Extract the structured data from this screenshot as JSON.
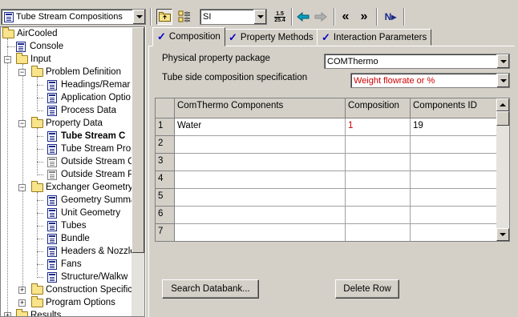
{
  "toolbar": {
    "nav_combo": "Tube Stream Compositions",
    "units_combo": "SI",
    "icons": [
      "tree-view-icon",
      "new-folder-icon",
      "list-icon",
      "units-conversion-icon",
      "back-arrow-icon",
      "forward-arrow-icon",
      "previous-icon",
      "next-icon",
      "next-input-icon"
    ],
    "units_glyph_top": "1.5",
    "units_glyph_bottom": "25.4",
    "prev_glyph": "«",
    "next_glyph": "»",
    "next_input_glyph": "N▸"
  },
  "tree": {
    "root": "AirCooled",
    "console": "Console",
    "input": "Input",
    "problem_definition": "Problem Definition",
    "headings": "Headings/Remar",
    "application_options": "Application Optio",
    "process_data": "Process Data",
    "property_data": "Property Data",
    "tube_stream_compositions": "Tube Stream C",
    "tube_stream_properties": "Tube Stream Prop",
    "outside_stream_compositions": "Outside Stream C",
    "outside_stream_properties": "Outside Stream P",
    "exchanger_geometry": "Exchanger Geometry",
    "geometry_summary": "Geometry Summa",
    "unit_geometry": "Unit Geometry",
    "tubes": "Tubes",
    "bundle": "Bundle",
    "headers_nozzles": "Headers & Nozzle",
    "fans": "Fans",
    "structure": "Structure/Walkw",
    "construction_specifications": "Construction Specific",
    "program_options": "Program Options",
    "results": "Results"
  },
  "tabs": [
    {
      "label": "Composition"
    },
    {
      "label": "Property Methods"
    },
    {
      "label": "Interaction Parameters"
    }
  ],
  "form": {
    "package_label": "Physical property package",
    "package_value": "COMThermo",
    "spec_label": "Tube side composition specification",
    "spec_value": "Weight flowrate or %"
  },
  "grid": {
    "columns": [
      "ComThermo Components",
      "Composition",
      "Components ID"
    ],
    "rows": [
      {
        "num": "1",
        "component": "Water",
        "composition": "1",
        "id": "19"
      },
      {
        "num": "2",
        "component": "",
        "composition": "",
        "id": ""
      },
      {
        "num": "3",
        "component": "",
        "composition": "",
        "id": ""
      },
      {
        "num": "4",
        "component": "",
        "composition": "",
        "id": ""
      },
      {
        "num": "5",
        "component": "",
        "composition": "",
        "id": ""
      },
      {
        "num": "6",
        "component": "",
        "composition": "",
        "id": ""
      },
      {
        "num": "7",
        "component": "",
        "composition": "",
        "id": ""
      }
    ]
  },
  "buttons": {
    "search": "Search Databank...",
    "delete_row": "Delete Row"
  },
  "colors": {
    "composition_value": "#cc0000",
    "spec_value": "#cc0000",
    "check": "#0000c8"
  }
}
